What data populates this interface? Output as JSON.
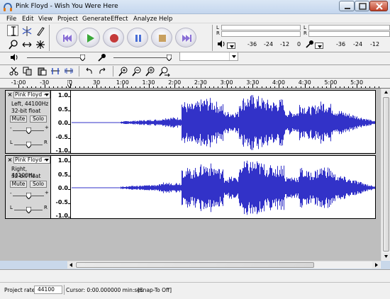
{
  "window": {
    "title": "Pink Floyd - Wish You Were Here",
    "minimize_label": "minimize",
    "maximize_label": "maximize",
    "close_label": "close"
  },
  "menu": [
    "File",
    "Edit",
    "View",
    "Project",
    "Generate",
    "Effect",
    "Analyze",
    "Help"
  ],
  "meters": {
    "playback_scale": [
      "-36",
      "-24",
      "-12",
      "0"
    ],
    "record_scale": [
      "-36",
      "-24",
      "-12"
    ],
    "left_label": "L",
    "right_label": "R"
  },
  "device": {
    "input_select_value": ""
  },
  "ruler": {
    "labels": [
      "-1:00",
      "-30",
      "0",
      "30",
      "1:00",
      "1:30",
      "2:00",
      "2:30",
      "3:00",
      "3:30",
      "4:00",
      "4:30",
      "5:00",
      "5:30"
    ]
  },
  "tracks": [
    {
      "name": "Pink Floyd -",
      "channel": "Left, 44100Hz",
      "format": "32-bit float",
      "mute_label": "Mute",
      "solo_label": "Solo",
      "gain_minus": "-",
      "gain_plus": "+",
      "pan_left": "L",
      "pan_right": "R",
      "scale": [
        "1.0",
        "0.5",
        "0.0",
        "-0.5",
        "-1.0"
      ]
    },
    {
      "name": "Pink Floyd -",
      "channel": "Right, 44100Hz",
      "format": "32-bit float",
      "mute_label": "Mute",
      "solo_label": "Solo",
      "gain_minus": "-",
      "gain_plus": "+",
      "pan_left": "L",
      "pan_right": "R",
      "scale": [
        "1.0",
        "0.5",
        "0.0",
        "-0.5",
        "-1.0"
      ]
    }
  ],
  "waveform_color": "#3232c8",
  "status": {
    "rate_label": "Project rate:",
    "rate_value": "44100",
    "cursor_text": "Cursor: 0:00.000000 min:sec",
    "snap_text": "[Snap-To Off]"
  }
}
